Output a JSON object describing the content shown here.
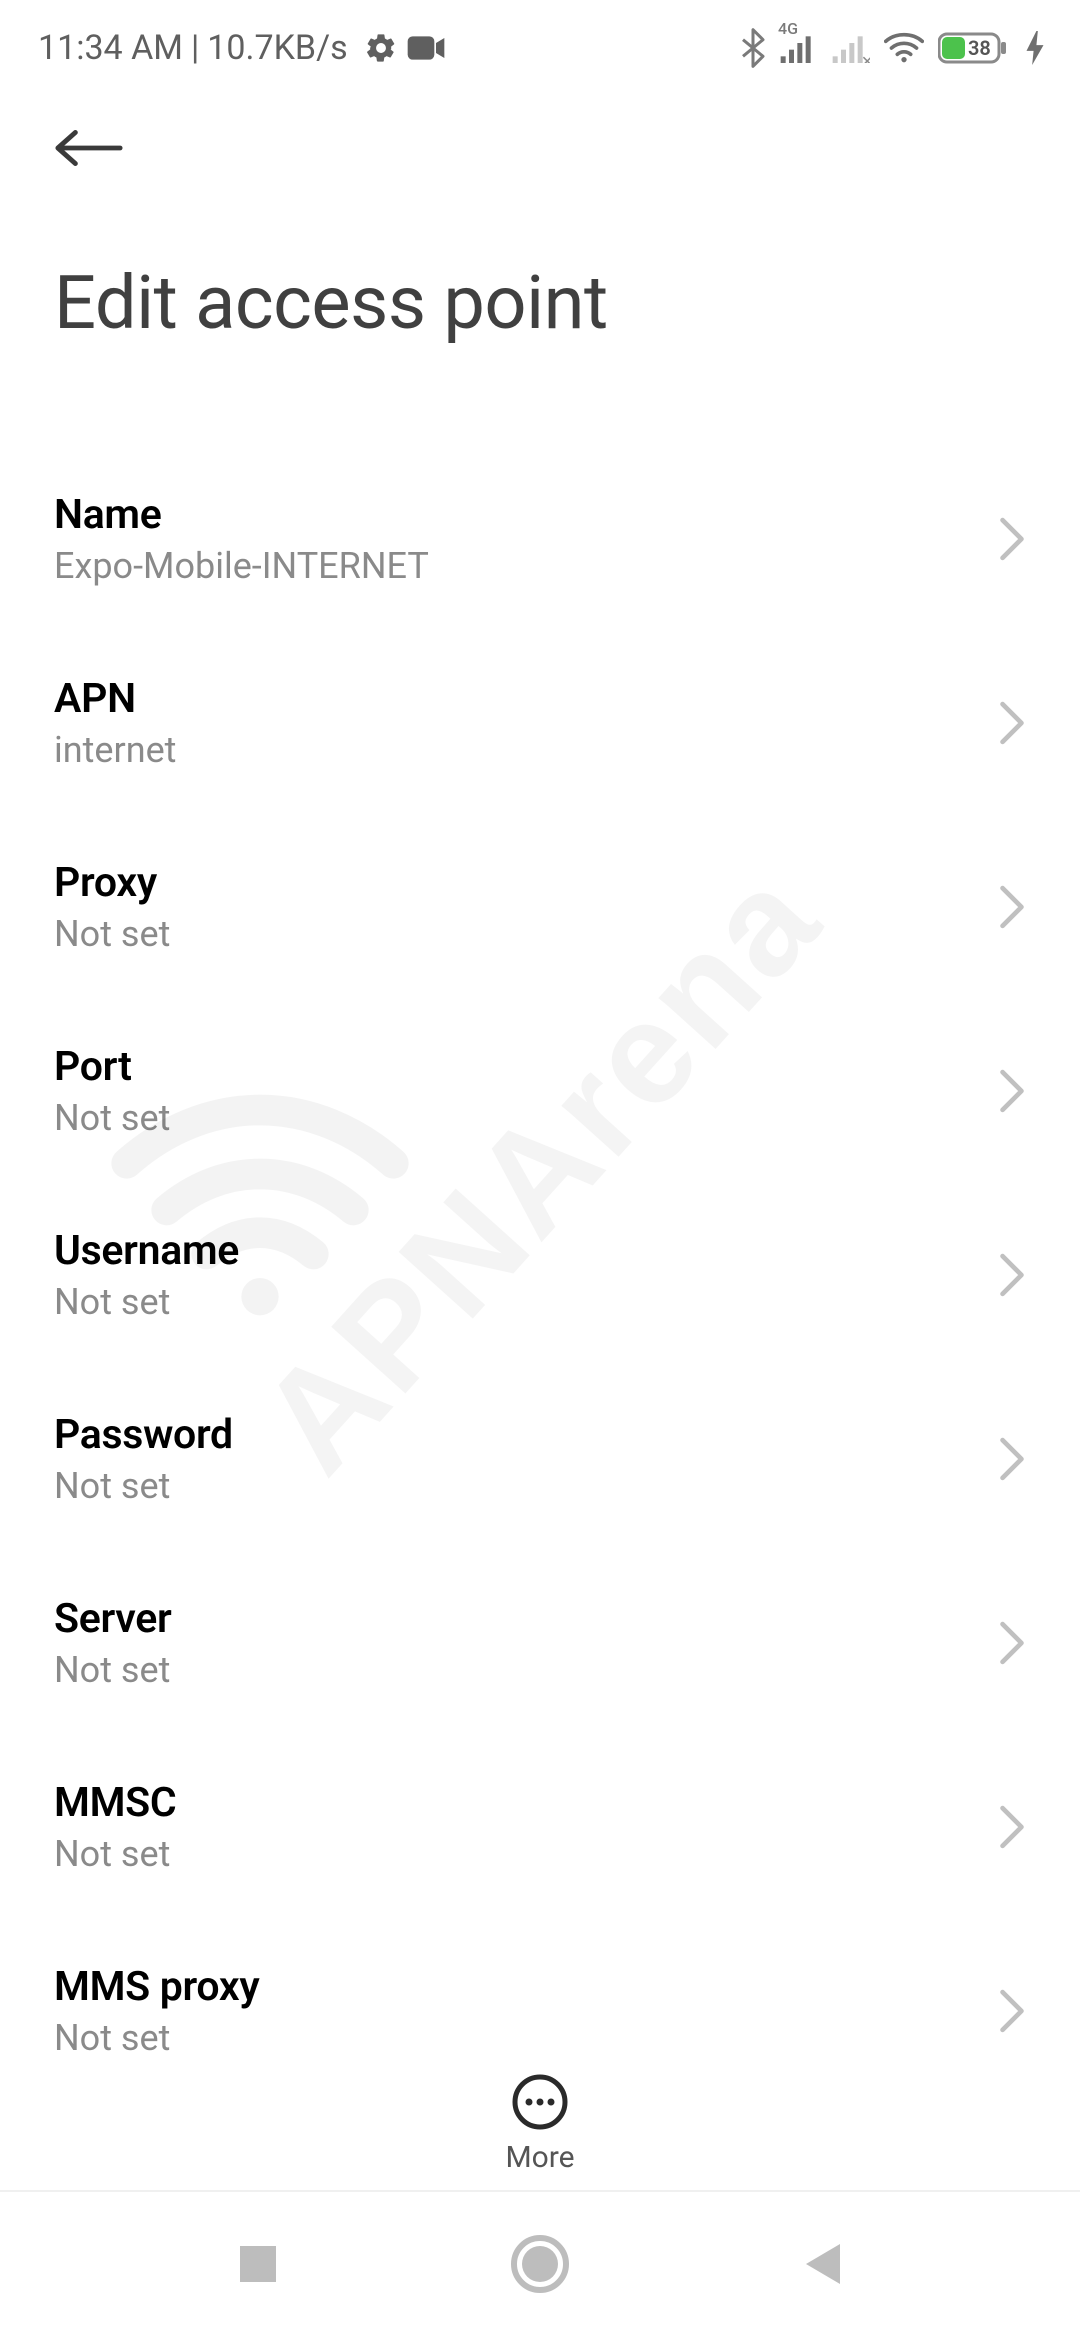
{
  "status_bar": {
    "time": "11:34 AM",
    "separator": " | ",
    "network_speed": "10.7KB/s",
    "battery_text": "38",
    "network_type": "4G"
  },
  "header": {
    "title": "Edit access point"
  },
  "settings": [
    {
      "title": "Name",
      "value": "Expo-Mobile-INTERNET"
    },
    {
      "title": "APN",
      "value": "internet"
    },
    {
      "title": "Proxy",
      "value": "Not set"
    },
    {
      "title": "Port",
      "value": "Not set"
    },
    {
      "title": "Username",
      "value": "Not set"
    },
    {
      "title": "Password",
      "value": "Not set"
    },
    {
      "title": "Server",
      "value": "Not set"
    },
    {
      "title": "MMSC",
      "value": "Not set"
    },
    {
      "title": "MMS proxy",
      "value": "Not set"
    }
  ],
  "bottom_action": {
    "more_label": "More"
  },
  "watermark": {
    "text": "APNArena"
  }
}
